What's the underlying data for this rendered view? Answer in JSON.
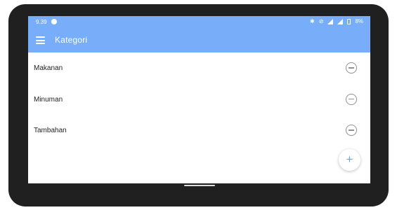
{
  "status_bar": {
    "time": "9.39",
    "battery": "8%",
    "icons": [
      "bluetooth-icon",
      "mute-icon",
      "wifi-icon",
      "signal-icon",
      "battery-icon"
    ]
  },
  "toolbar": {
    "title": "Kategori",
    "menu_icon": "hamburger-menu-icon"
  },
  "categories": [
    {
      "label": "Makanan",
      "action_icon": "remove-circle-icon"
    },
    {
      "label": "Minuman",
      "action_icon": "remove-circle-icon"
    },
    {
      "label": "Tambahan",
      "action_icon": "remove-circle-icon"
    }
  ],
  "fab": {
    "label": "+",
    "icon": "add-icon"
  },
  "colors": {
    "accent": "#78aef9",
    "device_bezel": "#202020",
    "icon_gray": "#8f8f8f"
  }
}
